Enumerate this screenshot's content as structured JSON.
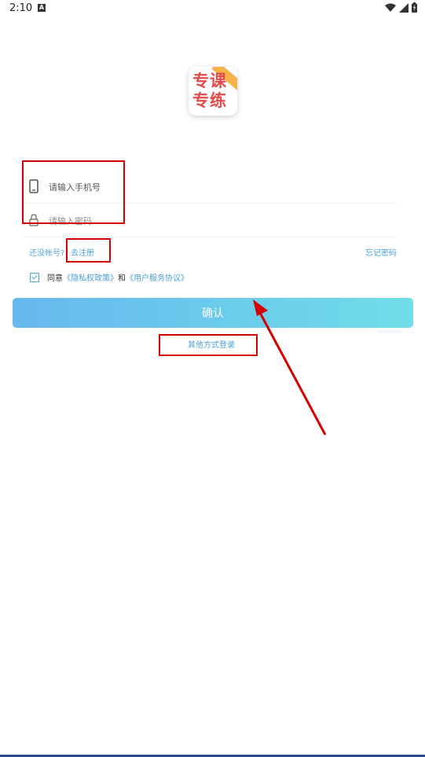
{
  "status_bar": {
    "time": "2:10",
    "notification_badge": "A"
  },
  "logo": {
    "text_line1": "专课",
    "text_line2": "专练"
  },
  "login_form": {
    "phone_placeholder": "请输入手机号",
    "password_placeholder": "请输入密码",
    "no_account_text": "还没帐号?",
    "register_label": "去注册",
    "forgot_password_label": "忘记密码",
    "agree_prefix": "同意",
    "privacy_policy_label": "《隐私权政策》",
    "agree_and": "和",
    "user_agreement_label": "《用户服务协议》",
    "confirm_label": "确认",
    "other_login_label": "其他方式登录"
  },
  "colors": {
    "accent": "#4a9fd6",
    "button_gradient_start": "#66b8ef",
    "button_gradient_end": "#70dde8",
    "annotation": "#d40000",
    "logo_text": "#e24b4b"
  },
  "icons": [
    "phone-icon",
    "lock-icon",
    "checkbox-checked-icon",
    "wifi-icon",
    "signal-icon",
    "battery-icon"
  ]
}
